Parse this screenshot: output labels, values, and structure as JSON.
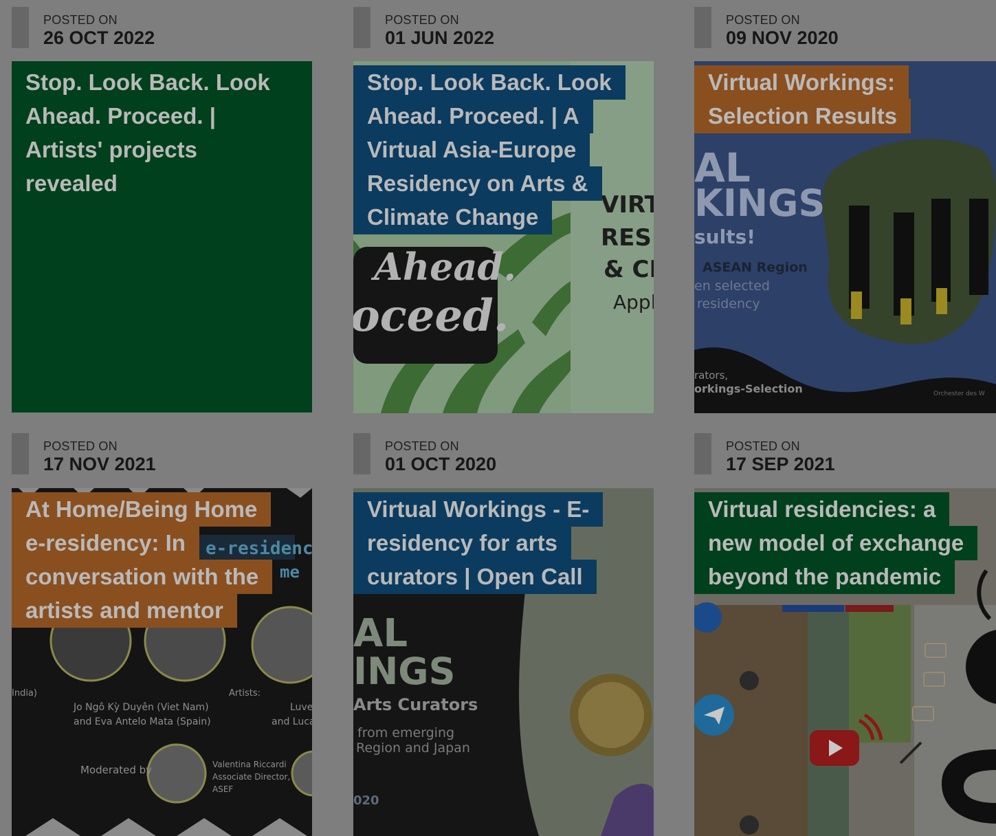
{
  "posts": [
    {
      "posted_label": "POSTED ON",
      "date": "26 OCT 2022",
      "title_lines": [
        "Stop. Look Back. Look",
        "Ahead. Proceed. |",
        "Artists' projects",
        "revealed"
      ],
      "title_bg": "#00401c"
    },
    {
      "posted_label": "POSTED ON",
      "date": "01 JUN 2022",
      "title_lines": [
        "Stop. Look Back. Look",
        "Ahead. Proceed. | A",
        "Virtual Asia-Europe",
        "Residency on Arts &",
        "Climate Change"
      ],
      "title_bg": "#0b3b5f",
      "image_text": [
        "Ahead.",
        "oceed.",
        "VIRTU",
        "RESID",
        "& CLI",
        "Apply"
      ]
    },
    {
      "posted_label": "POSTED ON",
      "date": "09 NOV 2020",
      "title_lines": [
        "Virtual Workings:",
        "Selection Results"
      ],
      "title_bg": "#8a4f1f",
      "image_text": [
        "AL",
        "KINGS",
        "sults!",
        "ASEAN Region",
        "en selected",
        "residency",
        "rators,",
        "orkings-Selection",
        "Orchester des W"
      ]
    },
    {
      "posted_label": "POSTED ON",
      "date": "17 NOV 2021",
      "title_lines": [
        "At Home/Being Home",
        "e-residency: In",
        "conversation with the",
        "artists and mentor"
      ],
      "title_bg": "#8a4f1f",
      "image_text": [
        "e-residency",
        "me",
        "India)",
        "Jo Ngô Kỳ Duyên (Viet Nam)",
        "and Eva Antelo Mata (Spain)",
        "Artists:",
        "Luve",
        "and Luca",
        "Moderated by",
        "Valentina Riccardi",
        "Associate Director,",
        "ASEF"
      ]
    },
    {
      "posted_label": "POSTED ON",
      "date": "01 OCT 2020",
      "title_lines": [
        "Virtual Workings - E-",
        "residency for arts",
        "curators | Open Call"
      ],
      "title_bg": "#0b3b5f",
      "image_text": [
        "AL",
        "INGS",
        "Arts Curators",
        "from emerging",
        "Region and Japan",
        "020"
      ]
    },
    {
      "posted_label": "POSTED ON",
      "date": "17 SEP 2021",
      "title_lines": [
        "Virtual residencies: a",
        "new model of exchange",
        "beyond the pandemic"
      ],
      "title_bg": "#00401c"
    }
  ]
}
